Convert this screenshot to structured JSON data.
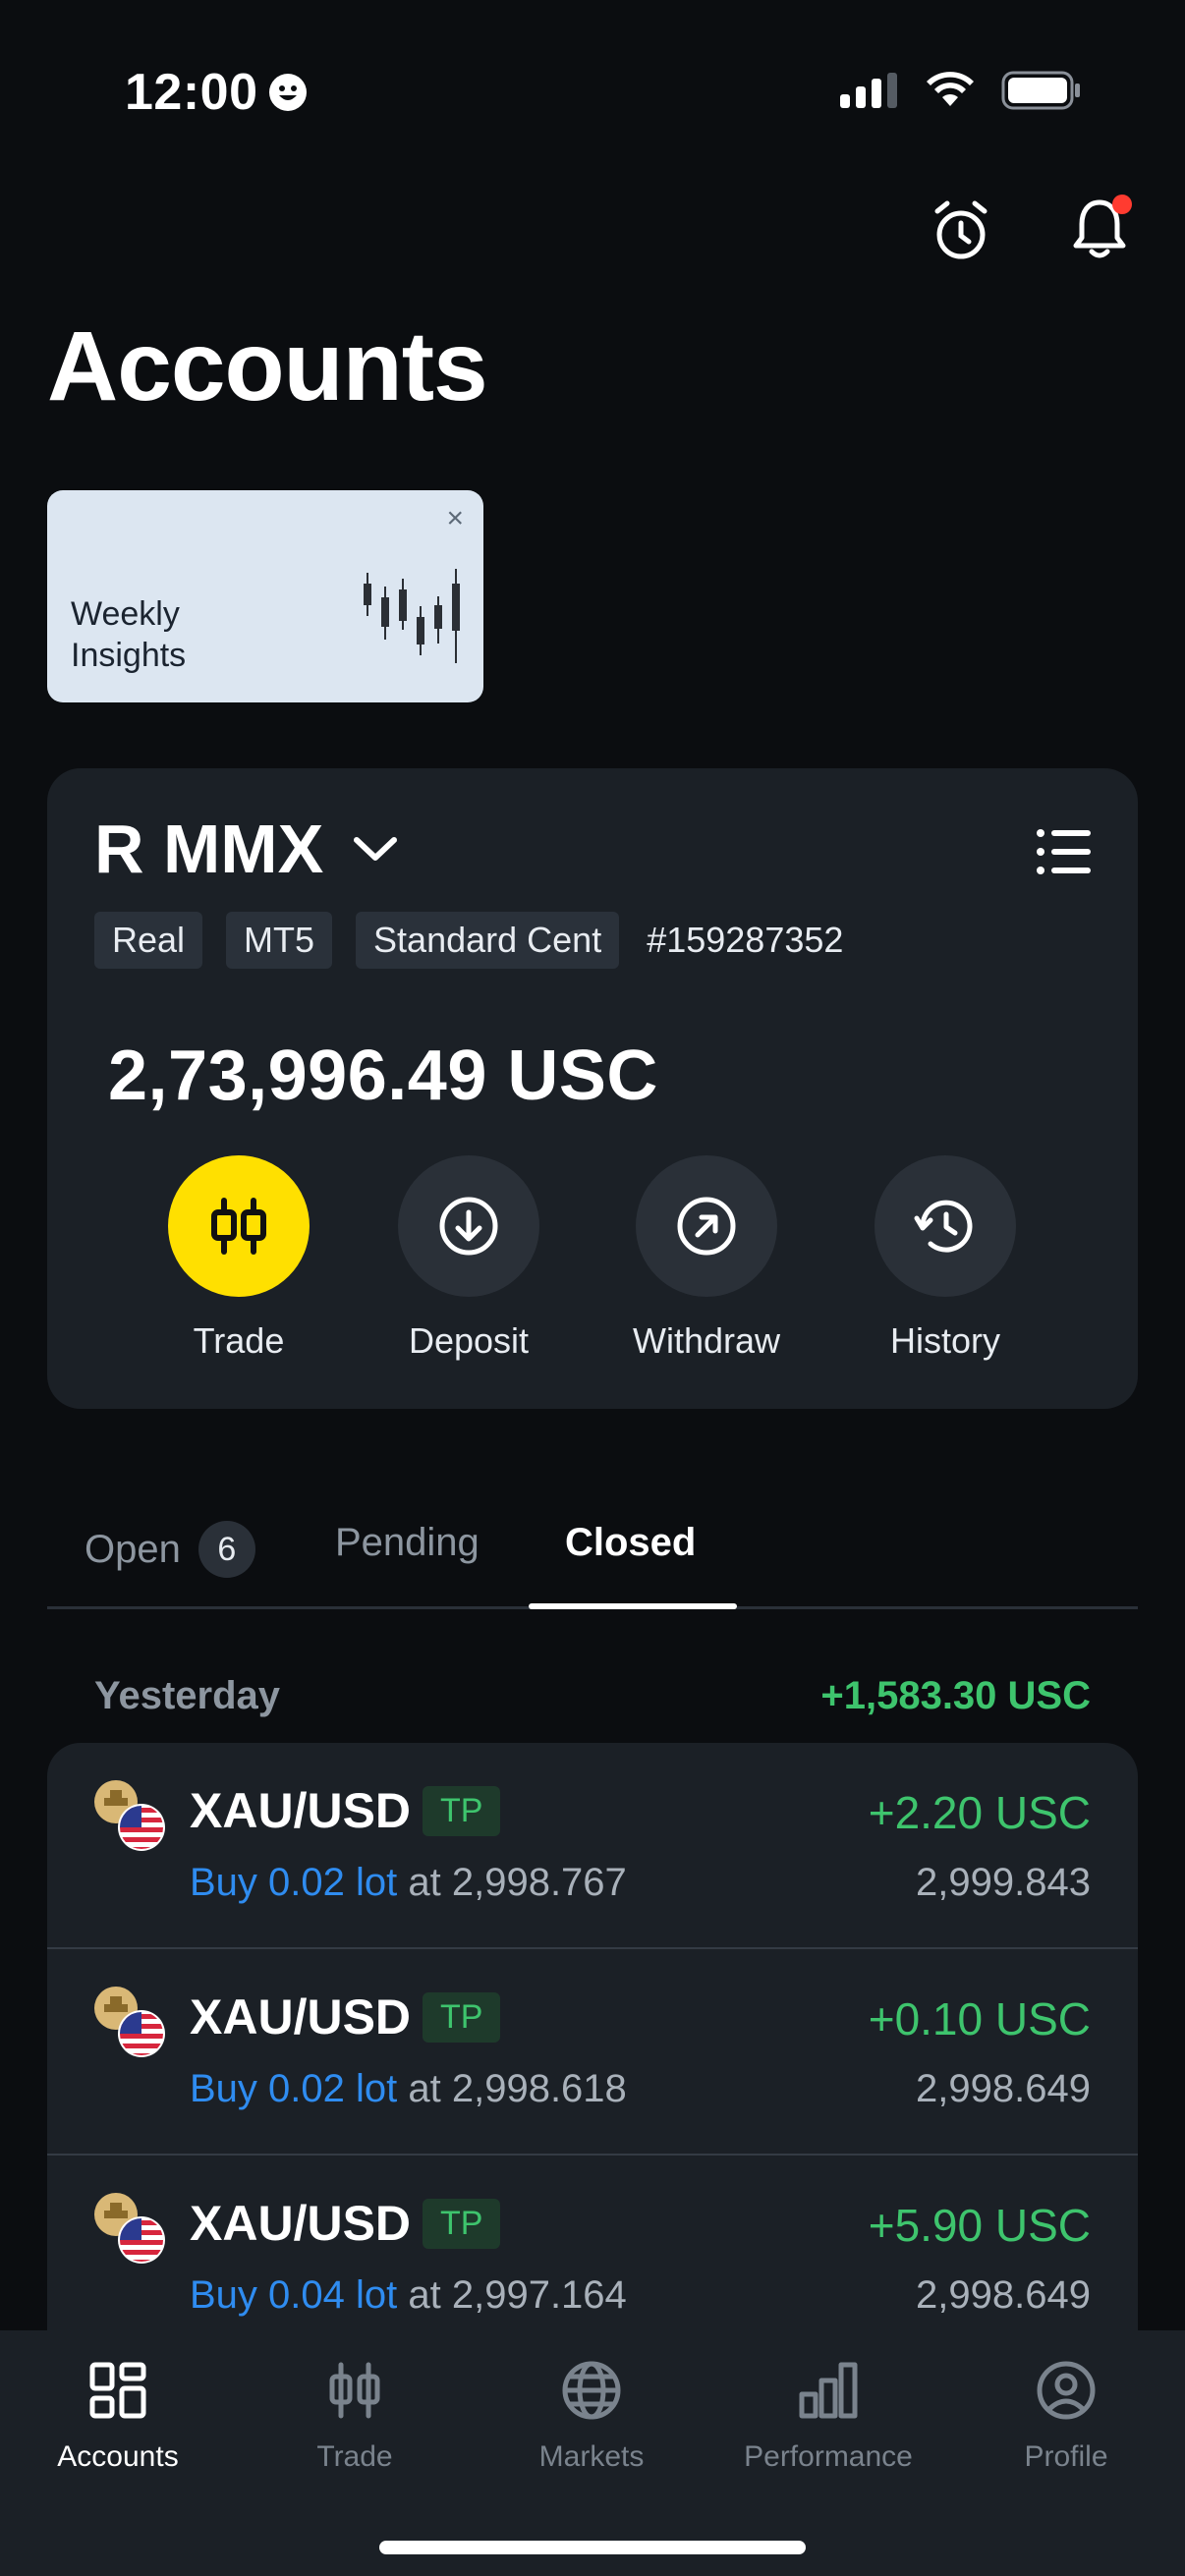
{
  "status_bar": {
    "time": "12:00"
  },
  "page": {
    "title": "Accounts"
  },
  "insights": {
    "title_line1": "Weekly",
    "title_line2": "Insights",
    "close": "×"
  },
  "account": {
    "name": "R MMX",
    "tags": [
      "Real",
      "MT5",
      "Standard Cent"
    ],
    "number": "#159287352",
    "balance": "2,73,996.49 USC",
    "actions": [
      {
        "label": "Trade",
        "icon": "trade-icon"
      },
      {
        "label": "Deposit",
        "icon": "deposit-icon"
      },
      {
        "label": "Withdraw",
        "icon": "withdraw-icon"
      },
      {
        "label": "History",
        "icon": "history-icon"
      }
    ]
  },
  "tabs": [
    {
      "label": "Open",
      "count": "6"
    },
    {
      "label": "Pending"
    },
    {
      "label": "Closed",
      "active": true
    }
  ],
  "group": {
    "label": "Yesterday",
    "total": "+1,583.30 USC"
  },
  "trades": [
    {
      "pair": "XAU/USD",
      "badge": "TP",
      "side": "Buy 0.02 lot",
      "at": "at 2,998.767",
      "pl": "+2.20 USC",
      "close": "2,999.843"
    },
    {
      "pair": "XAU/USD",
      "badge": "TP",
      "side": "Buy 0.02 lot",
      "at": "at 2,998.618",
      "pl": "+0.10 USC",
      "close": "2,998.649"
    },
    {
      "pair": "XAU/USD",
      "badge": "TP",
      "side": "Buy 0.04 lot",
      "at": "at 2,997.164",
      "pl": "+5.90 USC",
      "close": "2,998.649"
    }
  ],
  "nav": [
    {
      "label": "Accounts",
      "icon": "accounts-icon",
      "active": true
    },
    {
      "label": "Trade",
      "icon": "trade-icon"
    },
    {
      "label": "Markets",
      "icon": "globe-icon"
    },
    {
      "label": "Performance",
      "icon": "bar-chart-icon"
    },
    {
      "label": "Profile",
      "icon": "profile-icon"
    }
  ],
  "colors": {
    "background": "#0b0d10",
    "card": "#1b2026",
    "accent_yellow": "#ffe000",
    "profit_green": "#3ec46d",
    "link_blue": "#2f8cf0"
  }
}
